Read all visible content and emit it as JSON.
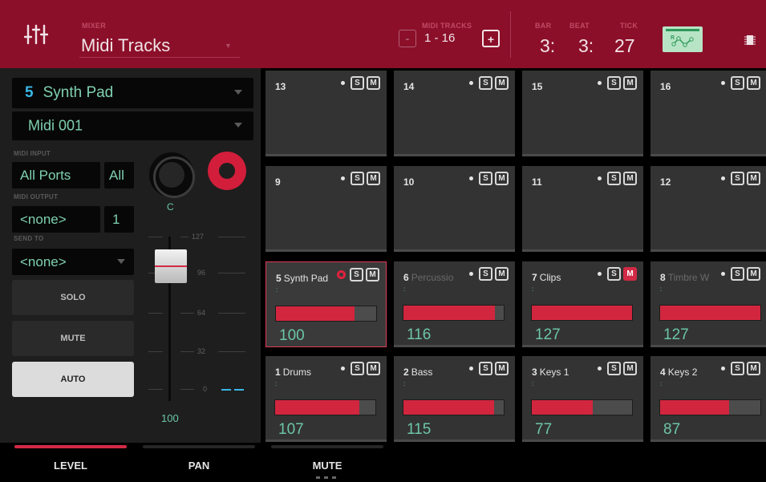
{
  "header": {
    "mode_label": "MIXER",
    "title": "Midi Tracks",
    "tracks_label": "MIDI TRACKS",
    "range": "1 - 16",
    "minus": "-",
    "plus": "+",
    "bar_label": "BAR",
    "beat_label": "BEAT",
    "tick_label": "TICK",
    "bar": "3:",
    "beat": "3:",
    "tick": "27"
  },
  "left": {
    "track_num": "5",
    "track_name": "Synth Pad",
    "clip": "Midi 001",
    "midi_input_label": "MIDI INPUT",
    "midi_input": "All Ports",
    "midi_input_channel": "All",
    "midi_output_label": "MIDI OUTPUT",
    "midi_output": "<none>",
    "midi_output_channel": "1",
    "send_to_label": "SEND TO",
    "send_to": "<none>",
    "solo": "SOLO",
    "mute": "MUTE",
    "auto": "AUTO",
    "pan": "C",
    "level": "100",
    "scale": [
      "127",
      "96",
      "64",
      "32",
      "0"
    ]
  },
  "pads": [
    {
      "num": "13",
      "name": "",
      "value": ""
    },
    {
      "num": "14",
      "name": "",
      "value": ""
    },
    {
      "num": "15",
      "name": "",
      "value": ""
    },
    {
      "num": "16",
      "name": "",
      "value": ""
    },
    {
      "num": "9",
      "name": "",
      "value": ""
    },
    {
      "num": "10",
      "name": "",
      "value": ""
    },
    {
      "num": "11",
      "name": "",
      "value": ""
    },
    {
      "num": "12",
      "name": "",
      "value": ""
    },
    {
      "num": "5",
      "name": "Synth Pad",
      "value": "100",
      "level": 0.787
    },
    {
      "num": "6",
      "name": "Percussio",
      "value": "116",
      "level": 0.913
    },
    {
      "num": "7",
      "name": "Clips",
      "value": "127",
      "level": 1.0
    },
    {
      "num": "8",
      "name": "Timbre W",
      "value": "127",
      "level": 1.0
    },
    {
      "num": "1",
      "name": "Drums",
      "value": "107",
      "level": 0.843
    },
    {
      "num": "2",
      "name": "Bass",
      "value": "115",
      "level": 0.906
    },
    {
      "num": "3",
      "name": "Keys 1",
      "value": "77",
      "level": 0.606
    },
    {
      "num": "4",
      "name": "Keys 2",
      "value": "87",
      "level": 0.685
    }
  ],
  "sm": {
    "s": "S",
    "m": "M"
  },
  "tabs": [
    "LEVEL",
    "PAN",
    "MUTE"
  ],
  "colors": {
    "accent": "#d2263f",
    "header": "#8c0f2a",
    "value_text": "#6cc6a6"
  }
}
